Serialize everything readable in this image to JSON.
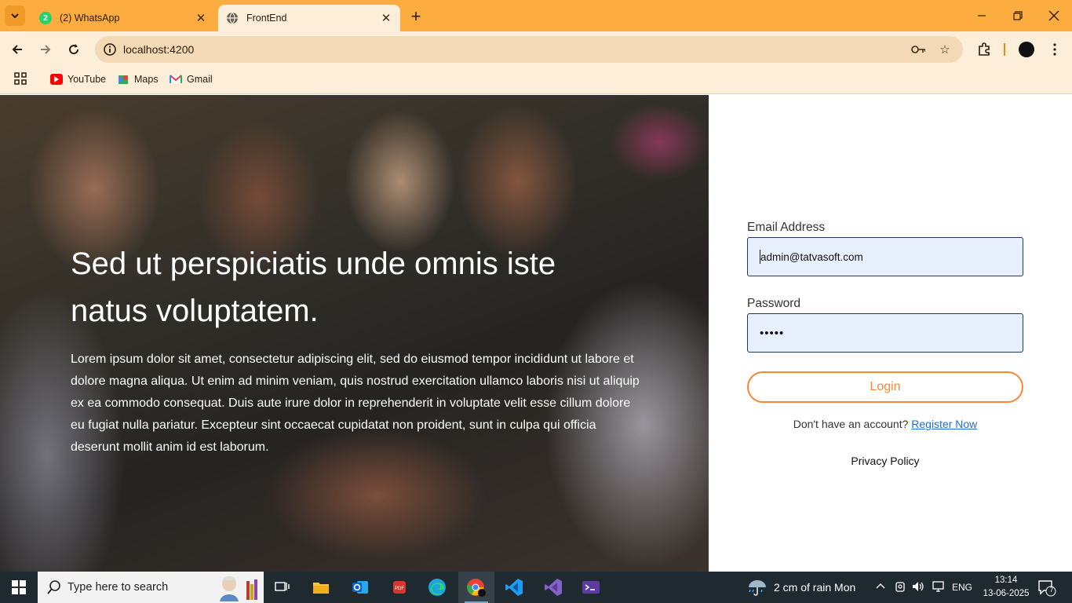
{
  "browser": {
    "tabs": [
      {
        "title": "(2) WhatsApp",
        "badge": "2",
        "active": false
      },
      {
        "title": "FrontEnd",
        "active": true
      }
    ],
    "url": "localhost:4200",
    "bookmarks": [
      {
        "label": "YouTube",
        "icon": "youtube-icon"
      },
      {
        "label": "Maps",
        "icon": "maps-icon"
      },
      {
        "label": "Gmail",
        "icon": "gmail-icon"
      }
    ]
  },
  "hero": {
    "title": "Sed ut perspiciatis unde omnis iste natus voluptatem.",
    "body": "Lorem ipsum dolor sit amet, consectetur adipiscing elit, sed do eiusmod tempor incididunt ut labore et dolore magna aliqua. Ut enim ad minim veniam, quis nostrud exercitation ullamco laboris nisi ut aliquip ex ea commodo consequat. Duis aute irure dolor in reprehenderit in voluptate velit esse cillum dolore eu fugiat nulla pariatur. Excepteur sint occaecat cupidatat non proident, sunt in culpa qui officia deserunt mollit anim id est laborum."
  },
  "login_form": {
    "email_label": "Email Address",
    "email_value": "admin@tatvasoft.com",
    "password_label": "Password",
    "password_value": "•••••",
    "login_button": "Login",
    "register_prompt": "Don't have an account?",
    "register_link": "Register Now",
    "privacy_link": "Privacy Policy"
  },
  "taskbar": {
    "search_placeholder": "Type here to search",
    "weather": "2 cm of rain Mon",
    "language": "ENG",
    "time": "13:14",
    "date": "13-06-2025",
    "notification_count": "7"
  },
  "colors": {
    "tab_strip": "#fdac3f",
    "toolbar": "#fdeed9",
    "accent": "#f88634",
    "input_bg": "#e8f0fe",
    "link": "#1f6fd1",
    "taskbar": "#1f2a30"
  }
}
